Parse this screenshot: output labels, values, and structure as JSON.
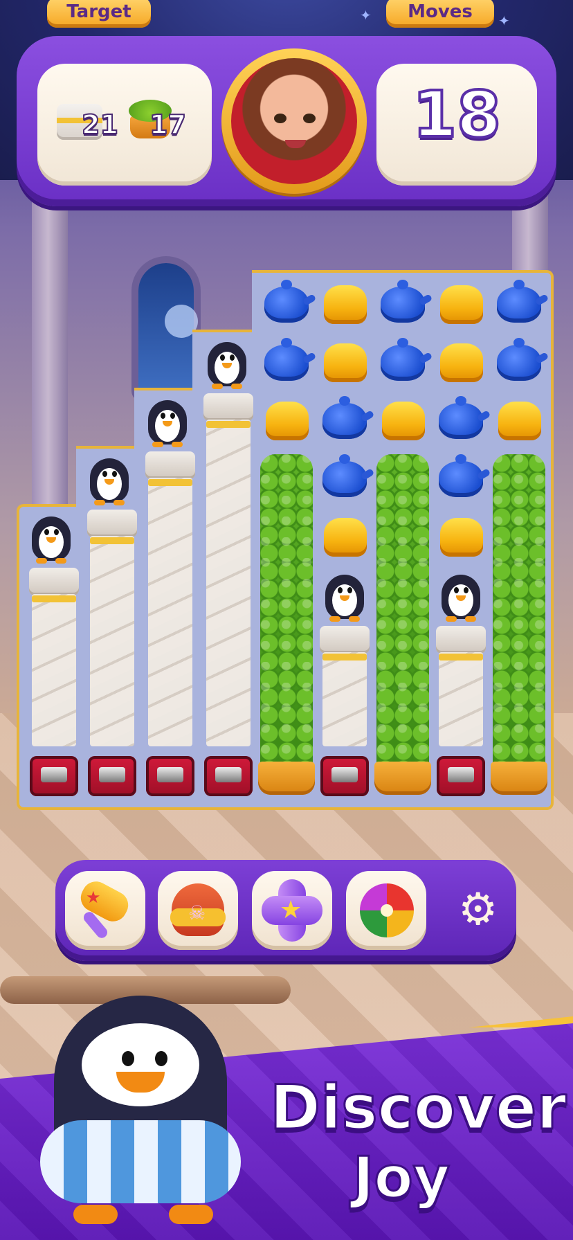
{
  "hud": {
    "target_label": "Target",
    "moves_label": "Moves",
    "moves_value": "18",
    "goals": [
      {
        "icon": "pillar-goal-icon",
        "count": "21"
      },
      {
        "icon": "hedge-goal-icon",
        "count": "17"
      }
    ]
  },
  "board": {
    "columns": [
      {
        "type": "penguin-pillar"
      },
      {
        "type": "penguin-pillar"
      },
      {
        "type": "penguin-pillar"
      },
      {
        "type": "penguin-pillar"
      },
      {
        "type": "hedge",
        "top_tiles": [
          "teapot",
          "teapot",
          "cake"
        ]
      },
      {
        "type": "mixed",
        "top_tiles": [
          "cake",
          "cake",
          "teapot",
          "teapot",
          "cake"
        ],
        "has_penguin": true
      },
      {
        "type": "hedge",
        "top_tiles": [
          "teapot",
          "teapot",
          "cake"
        ]
      },
      {
        "type": "mixed",
        "top_tiles": [
          "cake",
          "cake",
          "teapot",
          "teapot",
          "cake"
        ],
        "has_penguin": true
      },
      {
        "type": "hedge",
        "top_tiles": [
          "teapot",
          "teapot",
          "cake"
        ]
      }
    ]
  },
  "boosters": [
    {
      "name": "hammer-icon"
    },
    {
      "name": "bomb-icon"
    },
    {
      "name": "cross-blast-icon"
    },
    {
      "name": "pinwheel-icon"
    },
    {
      "name": "gear-icon"
    }
  ],
  "banner": {
    "line1": "Discover",
    "line2": "Joy"
  },
  "colors": {
    "hud_purple": "#7a3fd6",
    "tag_orange": "#f6a623",
    "board_bg": "#a9b3dd",
    "board_border": "#e7b43a",
    "teapot_blue": "#2b5ce0",
    "cake_yellow": "#f7b310",
    "hedge_green": "#4f9a1a"
  }
}
